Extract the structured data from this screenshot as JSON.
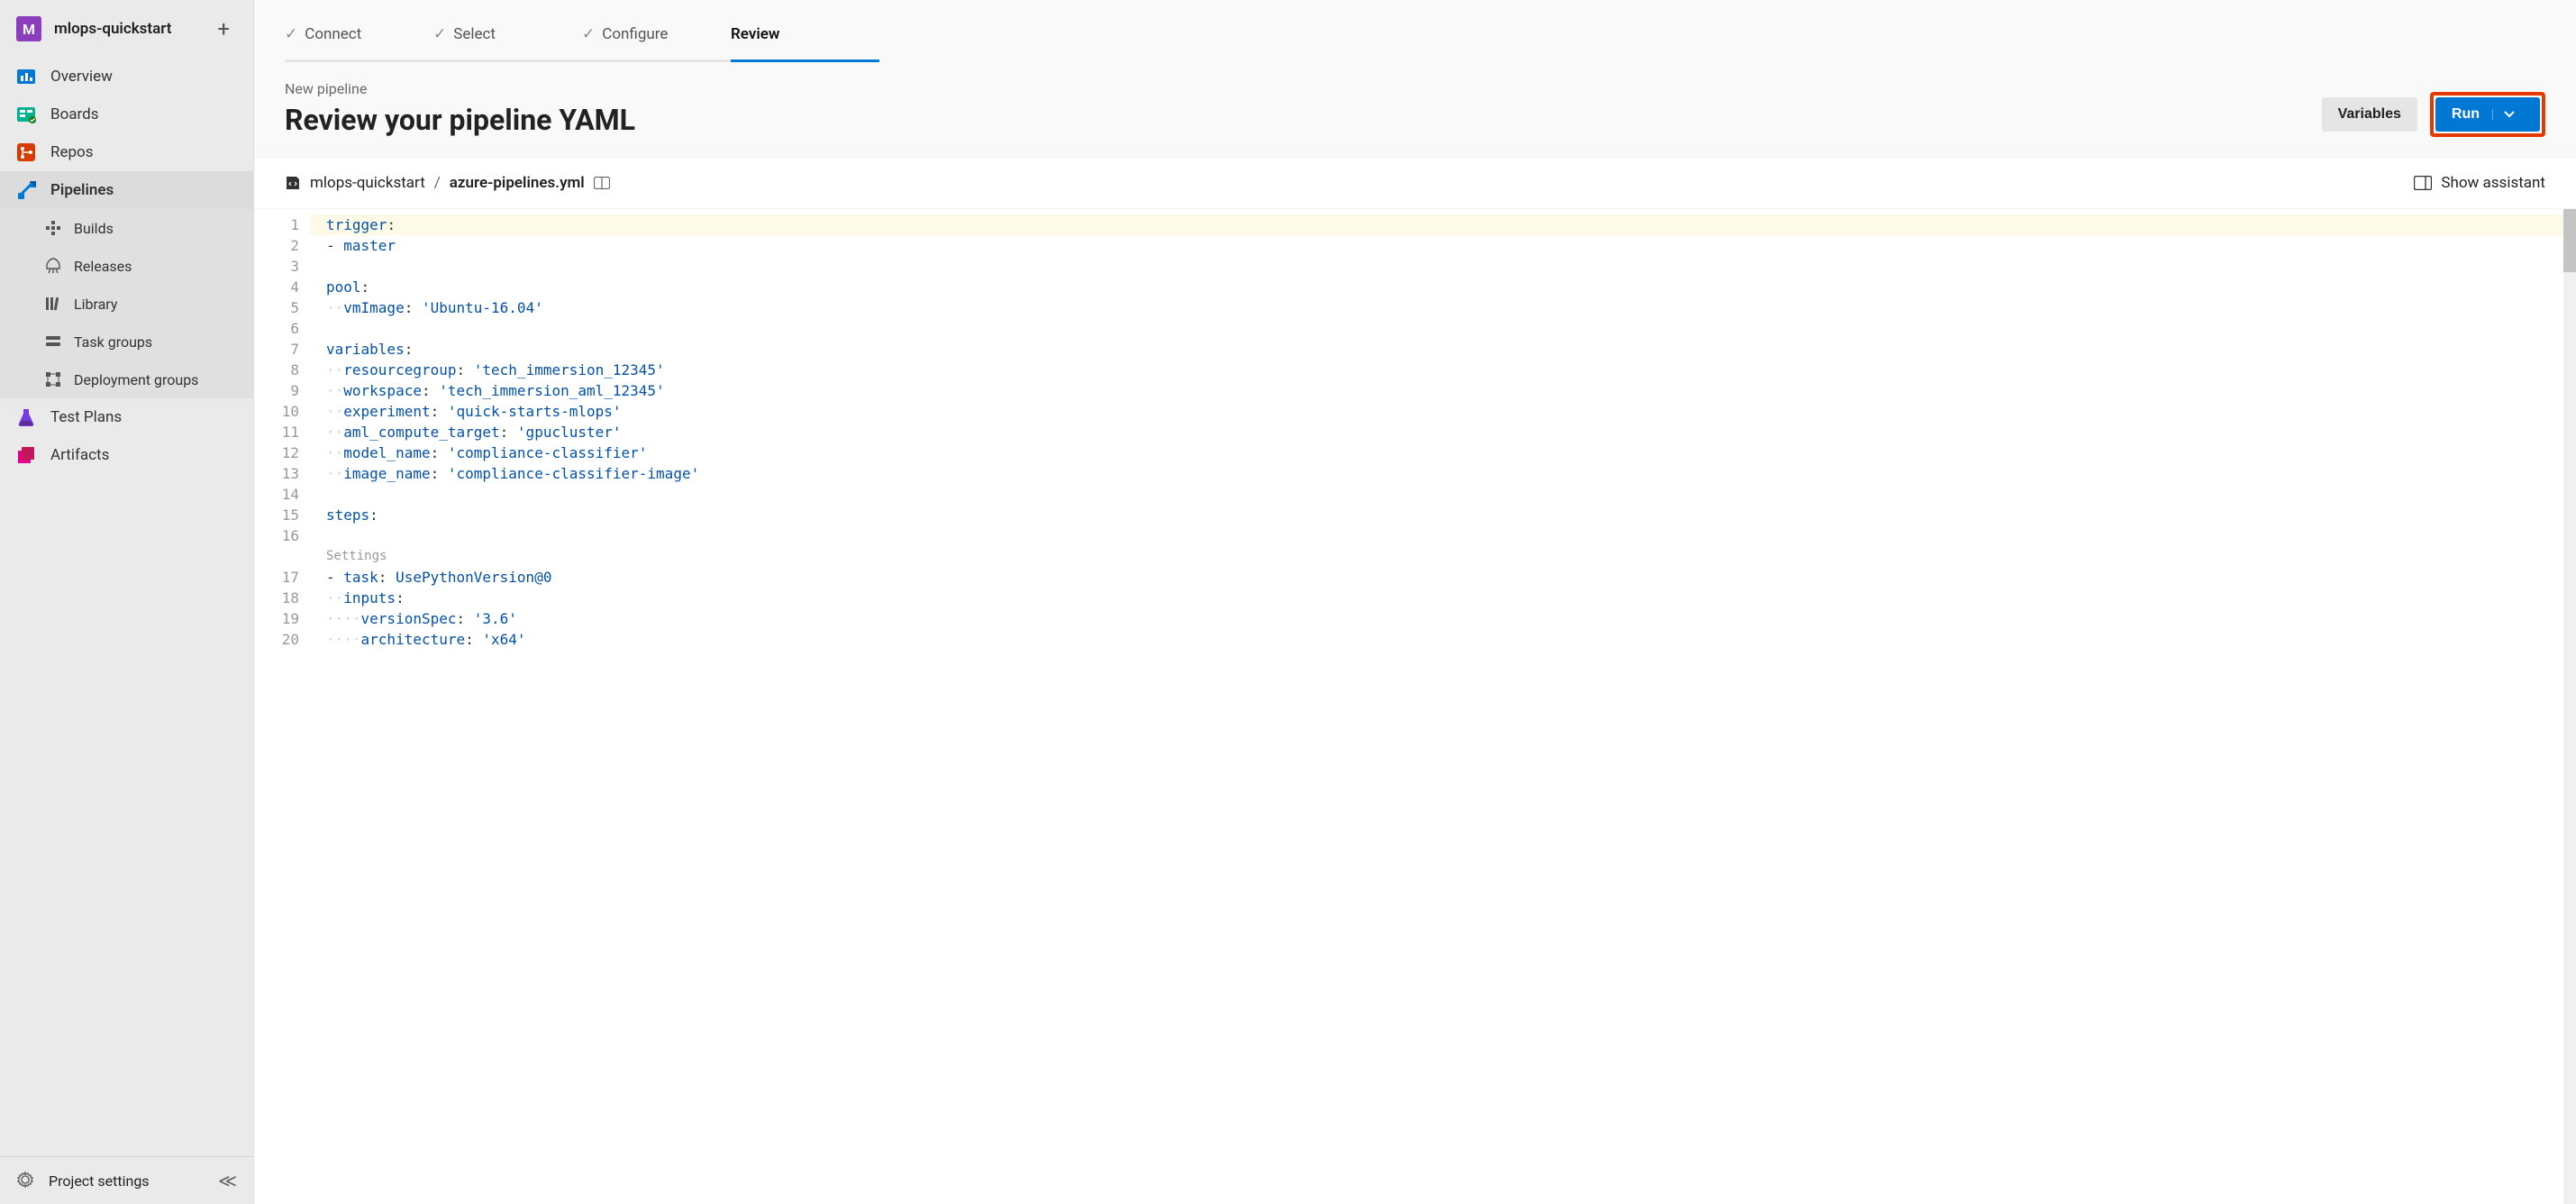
{
  "project": {
    "initial": "M",
    "name": "mlops-quickstart"
  },
  "sidebar": {
    "items": [
      {
        "label": "Overview"
      },
      {
        "label": "Boards"
      },
      {
        "label": "Repos"
      },
      {
        "label": "Pipelines"
      },
      {
        "label": "Builds"
      },
      {
        "label": "Releases"
      },
      {
        "label": "Library"
      },
      {
        "label": "Task groups"
      },
      {
        "label": "Deployment groups"
      },
      {
        "label": "Test Plans"
      },
      {
        "label": "Artifacts"
      }
    ],
    "footer": "Project settings"
  },
  "wizard": {
    "tabs": [
      "Connect",
      "Select",
      "Configure",
      "Review"
    ]
  },
  "header": {
    "breadcrumb": "New pipeline",
    "title": "Review your pipeline YAML",
    "variables_btn": "Variables",
    "run_btn": "Run"
  },
  "filebar": {
    "repo": "mlops-quickstart",
    "filename": "azure-pipelines.yml",
    "assistant": "Show assistant"
  },
  "editor": {
    "codelens": "Settings",
    "lines": [
      [
        [
          "kw",
          "trigger"
        ],
        [
          "punct",
          ":"
        ]
      ],
      [
        [
          "punct",
          "- "
        ],
        [
          "kw",
          "master"
        ]
      ],
      [],
      [
        [
          "kw",
          "pool"
        ],
        [
          "punct",
          ":"
        ]
      ],
      [
        [
          "ws",
          "··"
        ],
        [
          "kw",
          "vmImage"
        ],
        [
          "punct",
          ": "
        ],
        [
          "str",
          "'Ubuntu-16.04'"
        ]
      ],
      [],
      [
        [
          "kw",
          "variables"
        ],
        [
          "punct",
          ":"
        ]
      ],
      [
        [
          "ws",
          "··"
        ],
        [
          "kw",
          "resourcegroup"
        ],
        [
          "punct",
          ": "
        ],
        [
          "str",
          "'tech_immersion_12345'"
        ]
      ],
      [
        [
          "ws",
          "··"
        ],
        [
          "kw",
          "workspace"
        ],
        [
          "punct",
          ": "
        ],
        [
          "str",
          "'tech_immersion_aml_12345'"
        ]
      ],
      [
        [
          "ws",
          "··"
        ],
        [
          "kw",
          "experiment"
        ],
        [
          "punct",
          ": "
        ],
        [
          "str",
          "'quick-starts-mlops'"
        ]
      ],
      [
        [
          "ws",
          "··"
        ],
        [
          "kw",
          "aml_compute_target"
        ],
        [
          "punct",
          ": "
        ],
        [
          "str",
          "'gpucluster'"
        ]
      ],
      [
        [
          "ws",
          "··"
        ],
        [
          "kw",
          "model_name"
        ],
        [
          "punct",
          ": "
        ],
        [
          "str",
          "'compliance-classifier'"
        ]
      ],
      [
        [
          "ws",
          "··"
        ],
        [
          "kw",
          "image_name"
        ],
        [
          "punct",
          ": "
        ],
        [
          "str",
          "'compliance-classifier-image'"
        ]
      ],
      [],
      [
        [
          "kw",
          "steps"
        ],
        [
          "punct",
          ":"
        ]
      ],
      [],
      [
        [
          "punct",
          "- "
        ],
        [
          "kw",
          "task"
        ],
        [
          "punct",
          ": "
        ],
        [
          "kw",
          "UsePythonVersion@0"
        ]
      ],
      [
        [
          "ws",
          "··"
        ],
        [
          "kw",
          "inputs"
        ],
        [
          "punct",
          ":"
        ]
      ],
      [
        [
          "ws",
          "····"
        ],
        [
          "kw",
          "versionSpec"
        ],
        [
          "punct",
          ": "
        ],
        [
          "str",
          "'3.6'"
        ]
      ],
      [
        [
          "ws",
          "····"
        ],
        [
          "kw",
          "architecture"
        ],
        [
          "punct",
          ": "
        ],
        [
          "str",
          "'x64'"
        ]
      ]
    ]
  }
}
